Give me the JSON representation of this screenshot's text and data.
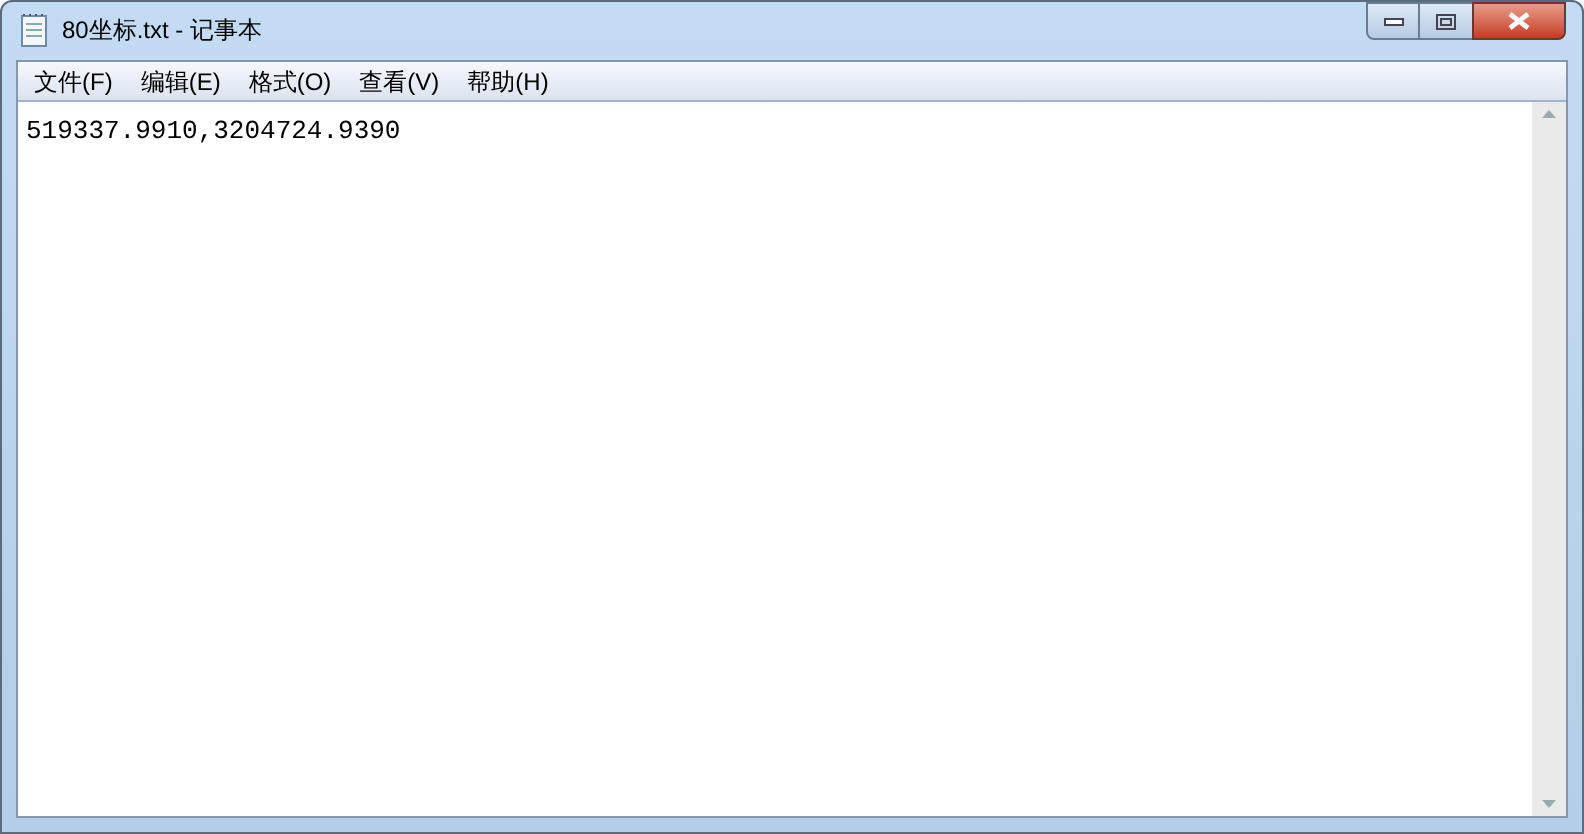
{
  "window": {
    "title": "80坐标.txt - 记事本"
  },
  "menu": [
    {
      "label": "文件(F)"
    },
    {
      "label": "编辑(E)"
    },
    {
      "label": "格式(O)"
    },
    {
      "label": "查看(V)"
    },
    {
      "label": "帮助(H)"
    }
  ],
  "document": {
    "text": "519337.9910,3204724.9390"
  }
}
